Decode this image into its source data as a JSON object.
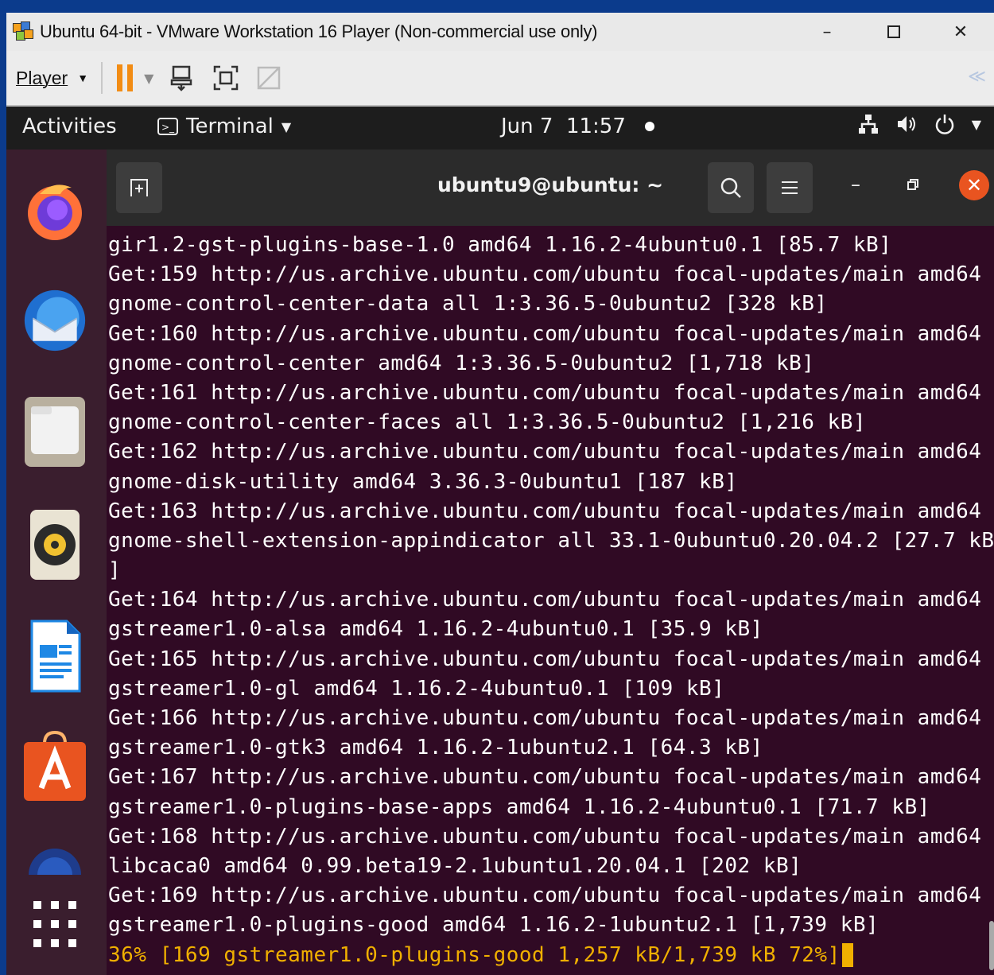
{
  "vmware": {
    "title": "Ubuntu 64-bit - VMware Workstation 16 Player (Non-commercial use only)",
    "min_glyph": "–",
    "max_glyph": "☐",
    "close_glyph": "✕",
    "player_label": "Player",
    "collapse_glyph": "≪"
  },
  "topbar": {
    "activities": "Activities",
    "app_menu": "Terminal",
    "datetime": "Jun 7  11:57"
  },
  "terminal": {
    "title": "ubuntu9@ubuntu: ~",
    "lines": [
      "gir1.2-gst-plugins-base-1.0 amd64 1.16.2-4ubuntu0.1 [85.7 kB]",
      "Get:159 http://us.archive.ubuntu.com/ubuntu focal-updates/main amd64",
      "gnome-control-center-data all 1:3.36.5-0ubuntu2 [328 kB]",
      "Get:160 http://us.archive.ubuntu.com/ubuntu focal-updates/main amd64",
      "gnome-control-center amd64 1:3.36.5-0ubuntu2 [1,718 kB]",
      "Get:161 http://us.archive.ubuntu.com/ubuntu focal-updates/main amd64",
      "gnome-control-center-faces all 1:3.36.5-0ubuntu2 [1,216 kB]",
      "Get:162 http://us.archive.ubuntu.com/ubuntu focal-updates/main amd64",
      "gnome-disk-utility amd64 3.36.3-0ubuntu1 [187 kB]",
      "Get:163 http://us.archive.ubuntu.com/ubuntu focal-updates/main amd64",
      "gnome-shell-extension-appindicator all 33.1-0ubuntu0.20.04.2 [27.7 kB",
      "]",
      "Get:164 http://us.archive.ubuntu.com/ubuntu focal-updates/main amd64",
      "gstreamer1.0-alsa amd64 1.16.2-4ubuntu0.1 [35.9 kB]",
      "Get:165 http://us.archive.ubuntu.com/ubuntu focal-updates/main amd64",
      "gstreamer1.0-gl amd64 1.16.2-4ubuntu0.1 [109 kB]",
      "Get:166 http://us.archive.ubuntu.com/ubuntu focal-updates/main amd64",
      "gstreamer1.0-gtk3 amd64 1.16.2-1ubuntu2.1 [64.3 kB]",
      "Get:167 http://us.archive.ubuntu.com/ubuntu focal-updates/main amd64",
      "gstreamer1.0-plugins-base-apps amd64 1.16.2-4ubuntu0.1 [71.7 kB]",
      "Get:168 http://us.archive.ubuntu.com/ubuntu focal-updates/main amd64",
      "libcaca0 amd64 0.99.beta19-2.1ubuntu1.20.04.1 [202 kB]",
      "Get:169 http://us.archive.ubuntu.com/ubuntu focal-updates/main amd64",
      "gstreamer1.0-plugins-good amd64 1.16.2-1ubuntu2.1 [1,739 kB]"
    ],
    "progress_line": "36% [169 gstreamer1.0-plugins-good 1,257 kB/1,739 kB 72%]"
  },
  "dock": {
    "apps": [
      "firefox-icon",
      "thunderbird-icon",
      "files-icon",
      "rhythmbox-icon",
      "libreoffice-writer-icon",
      "software-center-icon",
      "help-icon",
      "show-apps-icon"
    ]
  },
  "colors": {
    "terminal_bg": "#300a24",
    "progress": "#f0b000",
    "close_accent": "#e95420",
    "pause": "#f28c14"
  }
}
